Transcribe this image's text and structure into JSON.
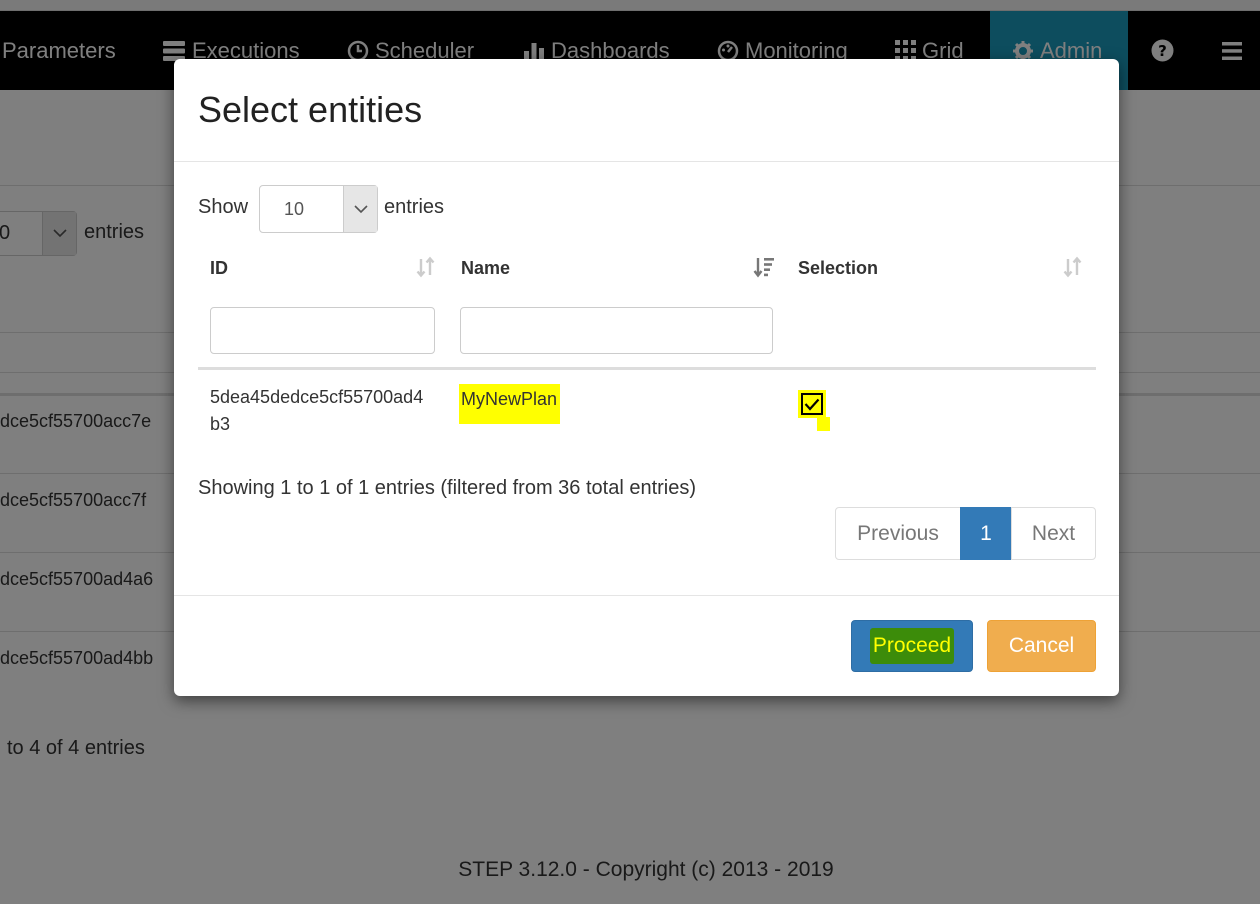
{
  "navbar": {
    "items": [
      {
        "label": "Parameters",
        "icon": "none"
      },
      {
        "label": "Executions",
        "icon": "server-icon"
      },
      {
        "label": "Scheduler",
        "icon": "clock-icon"
      },
      {
        "label": "Dashboards",
        "icon": "bar-chart-icon"
      },
      {
        "label": "Monitoring",
        "icon": "gauge-icon"
      },
      {
        "label": "Grid",
        "icon": "grid-icon"
      },
      {
        "label": "Admin",
        "icon": "gear-icon",
        "active": true
      }
    ],
    "help_icon": "question-circle-icon",
    "menu_icon": "hamburger-icon",
    "active_color": "#1a9bbd"
  },
  "background": {
    "length_value": "0",
    "entries_label": "entries",
    "row_ids": [
      "dce5cf55700acc7e",
      "dce5cf55700acc7f",
      "dce5cf55700ad4a6",
      "dce5cf55700ad4bb"
    ],
    "info": "to 4 of 4 entries",
    "footer": "STEP 3.12.0 - Copyright (c) 2013 - 2019"
  },
  "modal": {
    "title": "Select entities",
    "show_label": "Show",
    "length_value": "10",
    "entries_label": "entries",
    "columns": [
      {
        "label": "ID",
        "sort": "unsorted"
      },
      {
        "label": "Name",
        "sort": "ascending"
      },
      {
        "label": "Selection",
        "sort": "unsorted"
      }
    ],
    "filters": {
      "id": "",
      "name": ""
    },
    "rows": [
      {
        "id_line1": "5dea45dedce5cf55700ad4",
        "id_line2": "b3",
        "name": "MyNewPlan",
        "selected": true
      }
    ],
    "info": "Showing 1 to 1 of 1 entries (filtered from 36 total entries)",
    "pagination": {
      "previous": "Previous",
      "current": "1",
      "next": "Next"
    },
    "buttons": {
      "proceed": "Proceed",
      "cancel": "Cancel"
    },
    "highlight_color": "#ffff00"
  }
}
